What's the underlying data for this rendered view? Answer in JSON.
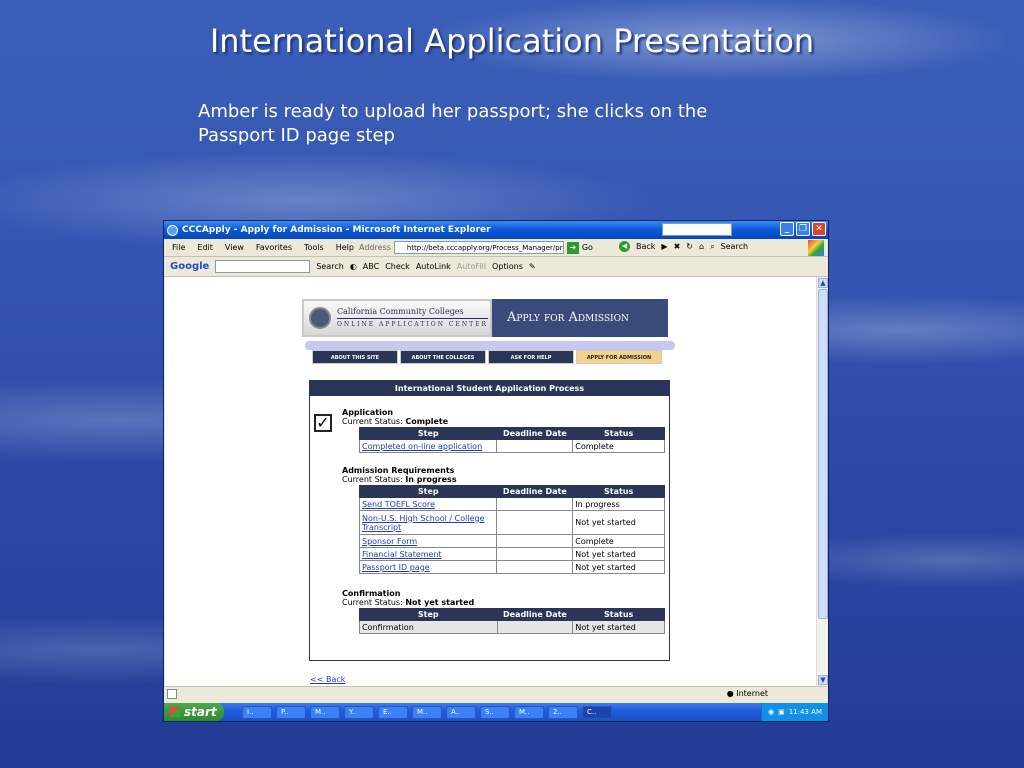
{
  "slide": {
    "title": "International Application Presentation",
    "subtitle": "Amber is ready to upload her passport; she clicks on the Passport ID page step"
  },
  "window": {
    "title": "CCCApply - Apply for Admission - Microsoft Internet Explorer",
    "menu": [
      "File",
      "Edit",
      "View",
      "Favorites",
      "Tools",
      "Help"
    ],
    "address_label": "Address",
    "address_url": "http://beta.cccapply.org/Process_Manager/proc",
    "go_label": "Go",
    "back_label": "Back",
    "search_label": "Search"
  },
  "googlebar": {
    "logo": "Google",
    "search_label": "Search",
    "check_label": "Check",
    "autolink_label": "AutoLink",
    "autofill_label": "AutoFill",
    "options_label": "Options"
  },
  "page": {
    "ccc_line1": "California Community Colleges",
    "ccc_line2": "ONLINE APPLICATION CENTER",
    "apply_title": "Apply for Admission",
    "nav": [
      "ABOUT THIS SITE",
      "ABOUT THE COLLEGES",
      "ASK FOR HELP",
      "APPLY FOR ADMISSION"
    ],
    "process_title": "International Student Application Process",
    "columns": {
      "step": "Step",
      "deadline": "Deadline Date",
      "status": "Status"
    },
    "status_prefix": "Current Status:",
    "sections": [
      {
        "title": "Application",
        "status": "Complete",
        "rows": [
          {
            "step": "Completed on-line application",
            "deadline": "",
            "status": "Complete"
          }
        ]
      },
      {
        "title": "Admission Requirements",
        "status": "In progress",
        "rows": [
          {
            "step": "Send TOEFL Score",
            "deadline": "",
            "status": "In progress"
          },
          {
            "step": "Non-U.S. High School / College Transcript",
            "deadline": "",
            "status": "Not yet started"
          },
          {
            "step": "Sponsor Form",
            "deadline": "",
            "status": "Complete"
          },
          {
            "step": "Financial Statement",
            "deadline": "",
            "status": "Not yet started"
          },
          {
            "step": "Passport ID page",
            "deadline": "",
            "status": "Not yet started"
          }
        ]
      },
      {
        "title": "Confirmation",
        "status": "Not yet started",
        "rows": [
          {
            "step": "Confirmation",
            "deadline": "",
            "status": "Not yet started"
          }
        ]
      }
    ],
    "back_link": "<< Back"
  },
  "statusbar": {
    "zone": "Internet"
  },
  "taskbar": {
    "start": "start",
    "tasks": [
      "I..",
      "P..",
      "M..",
      "Y..",
      "E..",
      "M..",
      "A..",
      "S..",
      "M..",
      "2..",
      "C.."
    ],
    "clock": "11:43 AM"
  }
}
